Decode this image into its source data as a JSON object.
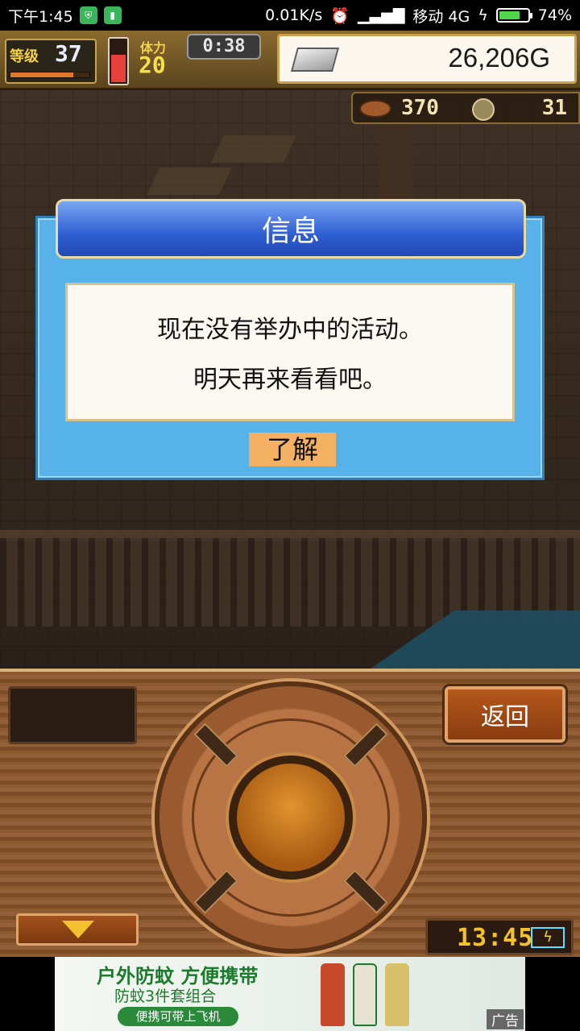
{
  "status_bar": {
    "time": "下午1:45",
    "network_speed": "0.01K/s",
    "carrier": "移动 4G",
    "battery": "74%",
    "battery_level": 0.74,
    "icons": [
      "shield-icon",
      "app-icon",
      "alarm-icon",
      "signal-icon",
      "charging-icon",
      "battery-icon"
    ]
  },
  "hud": {
    "level_label": "等级",
    "level": "37",
    "exp_fraction": 0.8,
    "hp_fraction": 0.6,
    "stamina_label": "体力",
    "stamina": "20",
    "timer": "0:38",
    "gold": "26,206G",
    "food": "370",
    "coins": "31"
  },
  "dialog": {
    "title": "信息",
    "line1": "现在没有举办中的活动。",
    "line2": "明天再来看看吧。",
    "ok_label": "了解"
  },
  "panel": {
    "back_label": "返回",
    "clock": "13:45"
  },
  "ad": {
    "headline": "户外防蚊  方便携带",
    "subline": "防蚊3件套组合",
    "pill": "便携可带上飞机",
    "tag": "广告"
  },
  "colors": {
    "dialog_blue": "#58b2ea",
    "ok_button": "#f4b063",
    "back_button": "#b4581c",
    "hud_gold": "#f2d24a"
  }
}
